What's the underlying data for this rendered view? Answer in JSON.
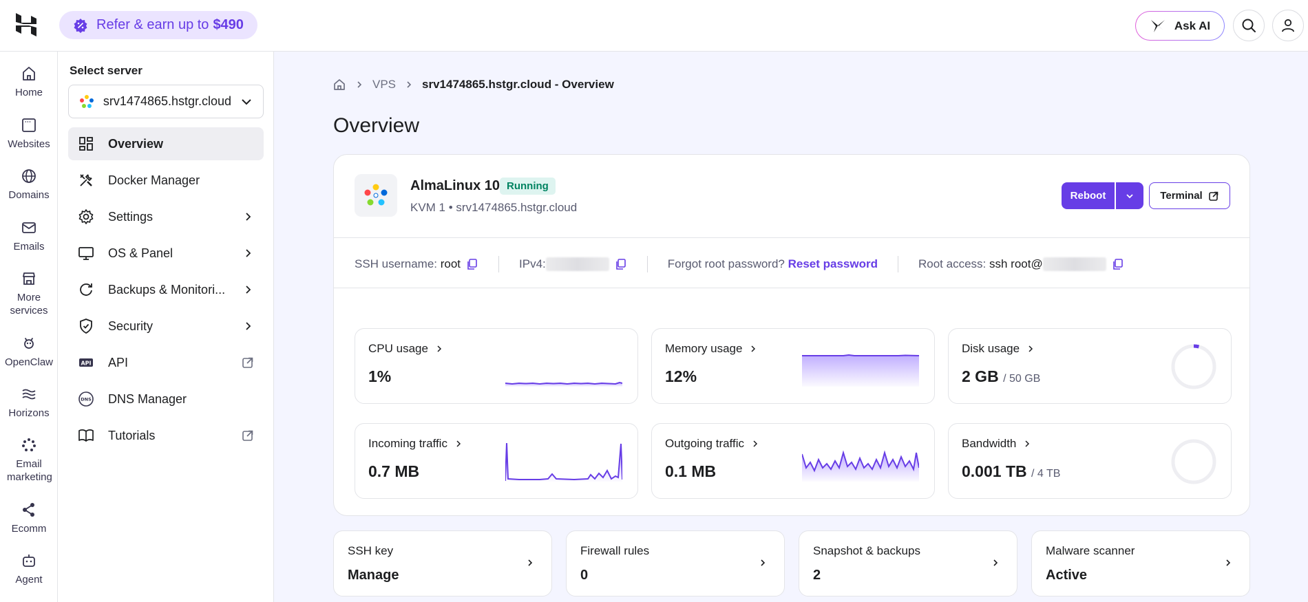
{
  "topbar": {
    "refer": {
      "text": "Refer & earn up to",
      "amount": "$490"
    },
    "ask_ai": "Ask AI"
  },
  "rail": [
    {
      "label": "Home",
      "icon": "home-icon"
    },
    {
      "label": "Websites",
      "icon": "browser-window-icon"
    },
    {
      "label": "Domains",
      "icon": "globe-icon"
    },
    {
      "label": "Emails",
      "icon": "mail-icon"
    },
    {
      "label": "More services",
      "icon": "store-icon"
    },
    {
      "label": "OpenClaw",
      "icon": "claw-icon"
    },
    {
      "label": "Horizons",
      "icon": "horizons-icon"
    },
    {
      "label": "Email marketing",
      "icon": "email-marketing-icon"
    },
    {
      "label": "Ecomm",
      "icon": "ecomm-icon"
    },
    {
      "label": "Agent",
      "icon": "agent-icon"
    }
  ],
  "sidebar": {
    "select_label": "Select server",
    "server": "srv1474865.hstgr.cloud",
    "items": [
      {
        "label": "Overview",
        "icon": "dashboard-icon"
      },
      {
        "label": "Docker Manager",
        "icon": "tools-icon"
      },
      {
        "label": "Settings",
        "icon": "gear-icon"
      },
      {
        "label": "OS & Panel",
        "icon": "monitor-icon"
      },
      {
        "label": "Backups & Monitori...",
        "icon": "refresh-icon"
      },
      {
        "label": "Security",
        "icon": "shield-icon"
      },
      {
        "label": "API",
        "icon": "api-icon"
      },
      {
        "label": "DNS Manager",
        "icon": "dns-icon"
      },
      {
        "label": "Tutorials",
        "icon": "book-icon"
      }
    ]
  },
  "breadcrumb": {
    "level1": "VPS",
    "current": "srv1474865.hstgr.cloud - Overview"
  },
  "page_title": "Overview",
  "server_card": {
    "os_name": "AlmaLinux 10",
    "status": "Running",
    "subtitle": "KVM 1 • srv1474865.hstgr.cloud",
    "reboot": "Reboot",
    "terminal": "Terminal",
    "ssh_label": "SSH username:",
    "ssh_user": "root",
    "ipv4_label": "IPv4:",
    "forgot_label": "Forgot root password?",
    "reset_link": "Reset password",
    "root_access_label": "Root access:",
    "root_access_value": "ssh root@"
  },
  "stats": {
    "cpu": {
      "label": "CPU usage",
      "value": "1%"
    },
    "memory": {
      "label": "Memory usage",
      "value": "12%"
    },
    "disk": {
      "label": "Disk usage",
      "value": "2 GB",
      "of": "/ 50 GB",
      "fraction": 0.04
    },
    "incoming": {
      "label": "Incoming traffic",
      "value": "0.7 MB"
    },
    "outgoing": {
      "label": "Outgoing traffic",
      "value": "0.1 MB"
    },
    "bandwidth": {
      "label": "Bandwidth",
      "value": "0.001 TB",
      "of": "/ 4 TB",
      "fraction": 0.0
    }
  },
  "mini_cards": [
    {
      "label": "SSH key",
      "value": "Manage"
    },
    {
      "label": "Firewall rules",
      "value": "0"
    },
    {
      "label": "Snapshot & backups",
      "value": "2"
    },
    {
      "label": "Malware scanner",
      "value": "Active"
    }
  ],
  "colors": {
    "accent": "#673de6",
    "running_bg": "#def4f0",
    "running_text": "#008361"
  }
}
